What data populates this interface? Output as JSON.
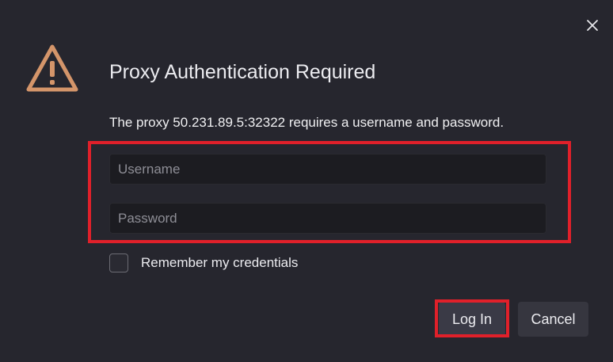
{
  "dialog": {
    "title": "Proxy Authentication Required",
    "message": "The proxy 50.231.89.5:32322 requires a username and password.",
    "icon": "warning-triangle-icon",
    "icon_color": "#d4956a",
    "close_icon": "close-icon"
  },
  "form": {
    "username": {
      "placeholder": "Username",
      "value": ""
    },
    "password": {
      "placeholder": "Password",
      "value": ""
    },
    "remember": {
      "label": "Remember my credentials",
      "checked": false
    }
  },
  "buttons": {
    "login_label": "Log In",
    "cancel_label": "Cancel"
  },
  "annotations": {
    "highlight_color": "#e0202a"
  }
}
